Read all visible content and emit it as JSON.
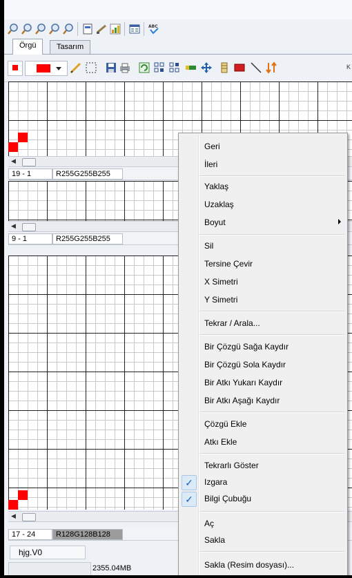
{
  "tabs": [
    "Örgü",
    "Tasarım"
  ],
  "toolbar2": {
    "cutoff_text": "K"
  },
  "panels": [
    {
      "position": "19 - 1",
      "color_text": "R255G255B255"
    },
    {
      "position": "9 - 1",
      "color_text": "R255G255B255"
    },
    {
      "position": "17 - 24",
      "color_text": "R128G128B128"
    }
  ],
  "bottom": {
    "filename": "hjg.V0",
    "memory": "2355.04MB"
  },
  "colors": {
    "accent_red": "#ff0000",
    "check_blue": "#1464c4",
    "menu_bg": "#f0f0f0"
  },
  "context_menu": {
    "items": [
      {
        "label": "Geri"
      },
      {
        "label": "İleri"
      },
      {
        "label": "Yaklaş"
      },
      {
        "label": "Uzaklaş"
      },
      {
        "label": "Boyut",
        "submenu": true
      },
      {
        "label": "Sil"
      },
      {
        "label": "Tersine Çevir"
      },
      {
        "label": "X Simetri"
      },
      {
        "label": "Y Simetri"
      },
      {
        "label": "Tekrar / Arala..."
      },
      {
        "label": "Bir Çözgü Sağa Kaydır"
      },
      {
        "label": "Bir Çözgü Sola Kaydır"
      },
      {
        "label": "Bir Atkı Yukarı Kaydır"
      },
      {
        "label": "Bir Atkı Aşağı Kaydır"
      },
      {
        "label": "Çözgü Ekle"
      },
      {
        "label": "Atkı Ekle"
      },
      {
        "label": "Tekrarlı Göster",
        "checked": false
      },
      {
        "label": "Izgara",
        "checked": true
      },
      {
        "label": "Bilgi Çubuğu",
        "checked": true
      },
      {
        "label": "Aç"
      },
      {
        "label": "Sakla"
      },
      {
        "label": "Sakla (Resim dosyası)..."
      }
    ]
  }
}
